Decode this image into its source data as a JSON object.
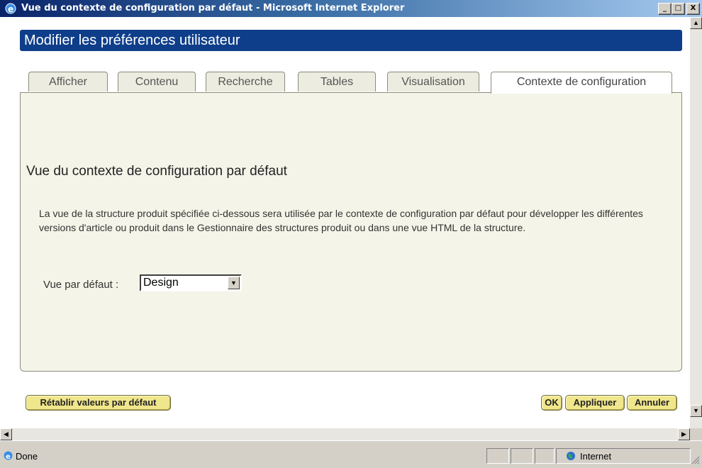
{
  "window": {
    "title": "Vue du contexte de configuration par défaut - Microsoft Internet Explorer",
    "minimize": "_",
    "maximize": "□",
    "close": "X"
  },
  "header": {
    "title": "Modifier les préférences utilisateur"
  },
  "tabs": [
    {
      "label": "Afficher",
      "active": false
    },
    {
      "label": "Contenu",
      "active": false
    },
    {
      "label": "Recherche",
      "active": false
    },
    {
      "label": "Tables",
      "active": false
    },
    {
      "label": "Visualisation",
      "active": false
    },
    {
      "label": "Contexte de configuration",
      "active": true
    }
  ],
  "main": {
    "section_title": "Vue du contexte de configuration par défaut",
    "description": "La vue de la structure produit spécifiée ci-dessous sera utilisée par le contexte de configuration par défaut pour développer les différentes versions d'article ou produit dans le Gestionnaire des structures produit ou dans une vue HTML de la structure.",
    "field_label": "Vue par défaut :",
    "select_value": "Design"
  },
  "buttons": {
    "reset": "Rétablir valeurs par défaut",
    "ok": "OK",
    "apply": "Appliquer",
    "cancel": "Annuler"
  },
  "statusbar": {
    "status": "Done",
    "zone": "Internet"
  },
  "colors": {
    "header_bg": "#0e3e8a",
    "button_bg": "#f0e68c",
    "panel_bg": "#f4f4e8"
  }
}
